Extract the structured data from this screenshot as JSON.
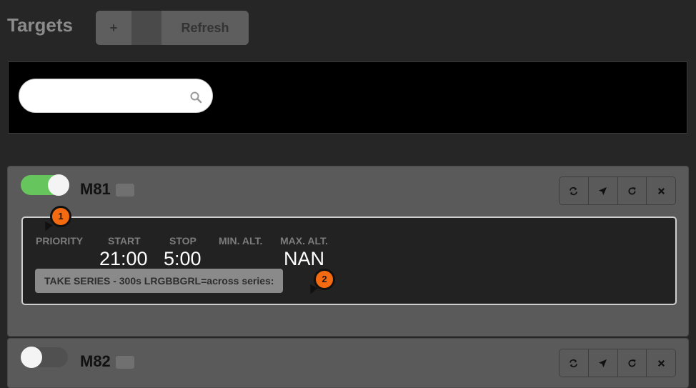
{
  "header": {
    "title": "Targets",
    "add_icon": "plus-icon",
    "add_label": "+",
    "refresh_label": "Refresh"
  },
  "search": {
    "value": "",
    "placeholder": "",
    "icon": "search-icon"
  },
  "targets": [
    {
      "enabled": true,
      "name": "M81",
      "columns": {
        "priority": "PRIORITY",
        "start": "START",
        "stop": "STOP",
        "min_alt": "MIN. ALT.",
        "max_alt": "MAX. ALT."
      },
      "values": {
        "priority": "",
        "start": "21:00",
        "stop": "5:00",
        "min_alt": "",
        "max_alt": "NAN"
      },
      "sequence": "TAKE SERIES - 300s LRGBBGRL=across series:",
      "actions": [
        "refresh-icon",
        "locate-icon",
        "reload-icon",
        "close-icon"
      ]
    },
    {
      "enabled": false,
      "name": "M82",
      "actions": [
        "refresh-icon",
        "locate-icon",
        "reload-icon",
        "close-icon"
      ]
    }
  ],
  "markers": [
    "1",
    "2"
  ],
  "colors": {
    "toggle_on": "#67c55e",
    "marker": "#f46a10",
    "background": "#262626"
  }
}
